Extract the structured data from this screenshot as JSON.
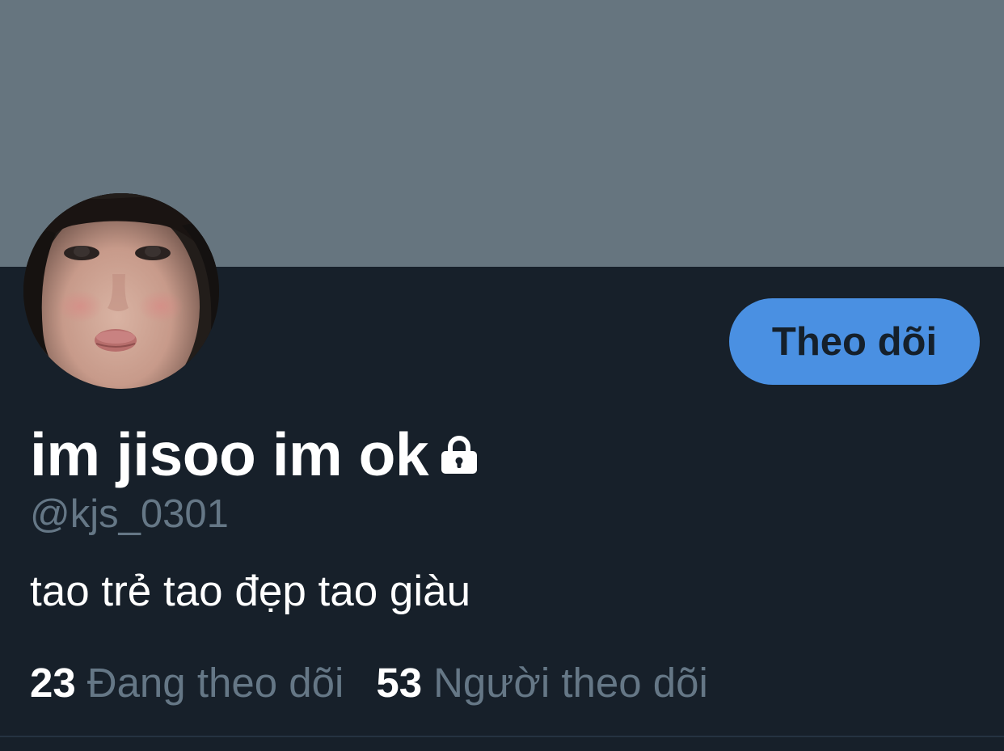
{
  "colors": {
    "banner": "#66757f",
    "background": "#17202a",
    "accent": "#4a90e2",
    "muted_text": "#657786",
    "primary_text": "#ffffff"
  },
  "profile": {
    "display_name": "im jisoo im ok",
    "protected_icon": "lock-icon",
    "handle": "@kjs_0301",
    "bio": "tao trẻ tao đẹp tao giàu",
    "avatar_icon": "profile-photo"
  },
  "actions": {
    "follow_label": "Theo dõi"
  },
  "stats": {
    "following_count": "23",
    "following_label": "Đang theo dõi",
    "followers_count": "53",
    "followers_label": "Người theo dõi"
  }
}
